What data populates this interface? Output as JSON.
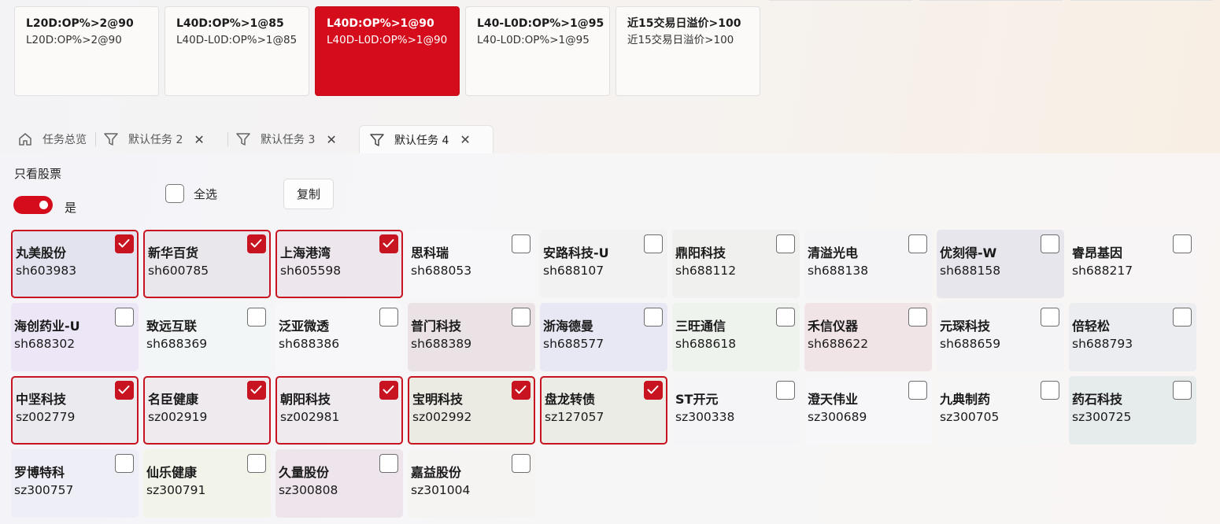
{
  "colors": {
    "accent": "#d50c1c",
    "checked_border": "#c81420"
  },
  "filters": [
    {
      "title": "L20D:OP%>2@90",
      "sub": "L20D:OP%>2@90",
      "selected": false
    },
    {
      "title": "L40D:OP%>1@85",
      "sub": "L40D-L0D:OP%>1@85",
      "selected": false
    },
    {
      "title": "L40D:OP%>1@90",
      "sub": "L40D-L0D:OP%>1@90",
      "selected": true
    },
    {
      "title": "L40-L0D:OP%>1@95",
      "sub": "L40-L0D:OP%>1@95",
      "selected": false
    },
    {
      "title": "近15交易日溢价>100",
      "sub": "近15交易日溢价>100",
      "selected": false
    }
  ],
  "tabs": [
    {
      "label": "任务总览",
      "icon": "home-icon",
      "closable": false,
      "active": false
    },
    {
      "label": "默认任务 2",
      "icon": "filter-icon",
      "closable": true,
      "active": false
    },
    {
      "label": "默认任务 3",
      "icon": "filter-icon",
      "closable": true,
      "active": false
    },
    {
      "label": "默认任务 4",
      "icon": "filter-icon",
      "closable": true,
      "active": true
    }
  ],
  "controls": {
    "only_stocks_label": "只看股票",
    "toggle_on": true,
    "toggle_text": "是",
    "select_all_label": "全选",
    "select_all_checked": false,
    "copy_label": "复制"
  },
  "stocks": [
    {
      "name": "丸美股份",
      "code": "sh603983",
      "checked": true,
      "bg": "#e2e3ef"
    },
    {
      "name": "新华百货",
      "code": "sh600785",
      "checked": true,
      "bg": "#e9e7eb"
    },
    {
      "name": "上海港湾",
      "code": "sh605598",
      "checked": true,
      "bg": "#ede6ec"
    },
    {
      "name": "思科瑞",
      "code": "sh688053",
      "checked": false,
      "bg": "#f7f7f9"
    },
    {
      "name": "安路科技-U",
      "code": "sh688107",
      "checked": false,
      "bg": "#f2f2f3"
    },
    {
      "name": "鼎阳科技",
      "code": "sh688112",
      "checked": false,
      "bg": "#f0f1ee"
    },
    {
      "name": "清溢光电",
      "code": "sh688138",
      "checked": false,
      "bg": "#f4f4f7"
    },
    {
      "name": "优刻得-W",
      "code": "sh688158",
      "checked": false,
      "bg": "#e6e6ec"
    },
    {
      "name": "睿昂基因",
      "code": "sh688217",
      "checked": false,
      "bg": "#f7f5f6"
    },
    {
      "name": "海创药业-U",
      "code": "sh688302",
      "checked": false,
      "bg": "#ede6f6"
    },
    {
      "name": "致远互联",
      "code": "sh688369",
      "checked": false,
      "bg": "#f2f6f6"
    },
    {
      "name": "泛亚微透",
      "code": "sh688386",
      "checked": false,
      "bg": "#f7f7f9"
    },
    {
      "name": "普门科技",
      "code": "sh688389",
      "checked": false,
      "bg": "#eae2e5"
    },
    {
      "name": "浙海德曼",
      "code": "sh688577",
      "checked": false,
      "bg": "#e7e8f4"
    },
    {
      "name": "三旺通信",
      "code": "sh688618",
      "checked": false,
      "bg": "#eff3ee"
    },
    {
      "name": "禾信仪器",
      "code": "sh688622",
      "checked": false,
      "bg": "#f1e4e7"
    },
    {
      "name": "元琛科技",
      "code": "sh688659",
      "checked": false,
      "bg": "#f4f4f6"
    },
    {
      "name": "倍轻松",
      "code": "sh688793",
      "checked": false,
      "bg": "#ebedf1"
    },
    {
      "name": "中坚科技",
      "code": "sz002779",
      "checked": true,
      "bg": "#ebeaef"
    },
    {
      "name": "名臣健康",
      "code": "sz002919",
      "checked": true,
      "bg": "#eeeaee"
    },
    {
      "name": "朝阳科技",
      "code": "sz002981",
      "checked": true,
      "bg": "#eeeaee"
    },
    {
      "name": "宝明科技",
      "code": "sz002992",
      "checked": true,
      "bg": "#ecebe3"
    },
    {
      "name": "盘龙转债",
      "code": "sz127057",
      "checked": true,
      "bg": "#ebece6"
    },
    {
      "name": "ST开元",
      "code": "sz300338",
      "checked": false,
      "bg": "#f5f5f8"
    },
    {
      "name": "澄天伟业",
      "code": "sz300689",
      "checked": false,
      "bg": "#f7f7f9"
    },
    {
      "name": "九典制药",
      "code": "sz300705",
      "checked": false,
      "bg": "#f7f6f7"
    },
    {
      "name": "药石科技",
      "code": "sz300725",
      "checked": false,
      "bg": "#e6ebec"
    },
    {
      "name": "罗博特科",
      "code": "sz300757",
      "checked": false,
      "bg": "#eeeef6"
    },
    {
      "name": "仙乐健康",
      "code": "sz300791",
      "checked": false,
      "bg": "#f2f3e9"
    },
    {
      "name": "久量股份",
      "code": "sz300808",
      "checked": false,
      "bg": "#ede4ec"
    },
    {
      "name": "嘉益股份",
      "code": "sz301004",
      "checked": false,
      "bg": "#f6f3f3"
    }
  ]
}
